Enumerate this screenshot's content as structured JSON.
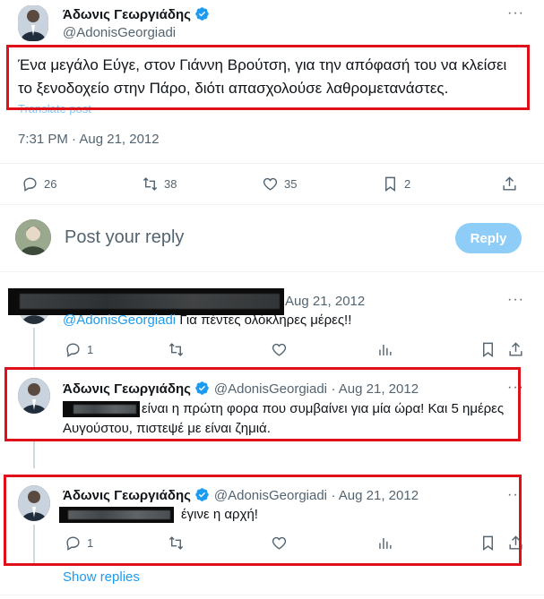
{
  "main_tweet": {
    "author_name": "Άδωνις Γεωργιάδης",
    "author_handle": "@AdonisGeorgiadi",
    "text": "Ένα μεγάλο Εύγε, στον Γιάννη Βρούτση, για την απόφασή του να κλείσει το ξενοδοχείο στην Πάρο, διότι απασχολούσε λαθρομετανάστες.",
    "translate_label": "Translate post",
    "timestamp": "7:31 PM · Aug 21, 2012",
    "replies": "26",
    "reposts": "38",
    "likes": "35",
    "bookmarks": "2"
  },
  "composer": {
    "placeholder": "Post your reply",
    "reply_button": "Reply"
  },
  "replies": [
    {
      "date": "Aug 21, 2012",
      "mention": "@AdonisGeorgiadi",
      "text": "Για πέντες ολόκληρες μέρες!!",
      "reply_count": "1"
    },
    {
      "author_name": "Άδωνις Γεωργιάδης",
      "author_handle": "@AdonisGeorgiadi",
      "date": "· Aug 21, 2012",
      "text_line1": "είναι η πρώτη φορα που συμβαίνει για μία ώρα! Και 5 ημέρες",
      "text_line2": "Αυγούστου, πιστεψέ με είναι ζημιά."
    },
    {
      "author_name": "Άδωνις Γεωργιάδης",
      "author_handle": "@AdonisGeorgiadi",
      "date": "· Aug 21, 2012",
      "text": "έγινε η αρχή!",
      "reply_count": "1"
    }
  ],
  "show_replies": "Show replies",
  "colors": {
    "accent": "#1d9bf0",
    "reply_button_bg": "#8ecdf8",
    "highlight_box": "#e0101a",
    "muted_text": "#536471"
  },
  "icons": [
    "verified-badge-icon",
    "more-icon",
    "reply-icon",
    "repost-icon",
    "like-icon",
    "bookmark-icon",
    "share-icon",
    "views-icon"
  ]
}
